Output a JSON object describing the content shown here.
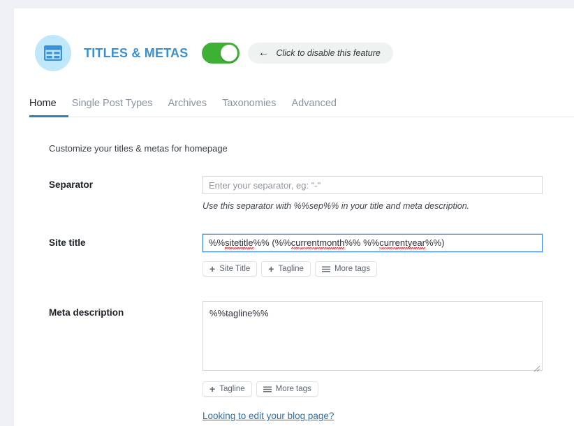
{
  "header": {
    "icon": "table-grid-icon",
    "title": "TITLES & METAS",
    "toggle": {
      "state": "on",
      "color": "#3eb034"
    },
    "hint": {
      "arrow": "←",
      "text": "Click to disable this feature"
    }
  },
  "tabs": [
    {
      "label": "Home",
      "active": true
    },
    {
      "label": "Single Post Types",
      "active": false
    },
    {
      "label": "Archives",
      "active": false
    },
    {
      "label": "Taxonomies",
      "active": false
    },
    {
      "label": "Advanced",
      "active": false
    }
  ],
  "main": {
    "intro": "Customize your titles & metas for homepage",
    "fields": {
      "separator": {
        "label": "Separator",
        "value": "",
        "placeholder": "Enter your separator, eg: \"-\"",
        "helper": "Use this separator with %%sep%% in your title and meta description."
      },
      "site_title": {
        "label": "Site title",
        "value": "%%sitetitle%% (%%currentmonth%% %%currentyear%%)",
        "value_parts": [
          {
            "text": "%%",
            "misspelled": false
          },
          {
            "text": "sitetitle",
            "misspelled": true
          },
          {
            "text": "%% (%%",
            "misspelled": false
          },
          {
            "text": "currentmonth",
            "misspelled": true
          },
          {
            "text": "%% %%",
            "misspelled": false
          },
          {
            "text": "currentyear",
            "misspelled": true
          },
          {
            "text": "%%)",
            "misspelled": false
          }
        ],
        "focused": true,
        "buttons": [
          {
            "icon": "plus-icon",
            "label": "Site Title"
          },
          {
            "icon": "plus-icon",
            "label": "Tagline"
          },
          {
            "icon": "hamburger-icon",
            "label": "More tags"
          }
        ]
      },
      "meta_description": {
        "label": "Meta description",
        "value": "%%tagline%%",
        "buttons": [
          {
            "icon": "plus-icon",
            "label": "Tagline"
          },
          {
            "icon": "hamburger-icon",
            "label": "More tags"
          }
        ]
      }
    },
    "blog_link": "Looking to edit your blog page?"
  },
  "colors": {
    "accent_blue": "#3b90d4",
    "tab_active_bar": "#2e7eb8",
    "toggle_green": "#3eb034",
    "icon_bg": "#bfe8fa",
    "link": "#2d6fa8",
    "page_bg": "#eef0f5"
  }
}
